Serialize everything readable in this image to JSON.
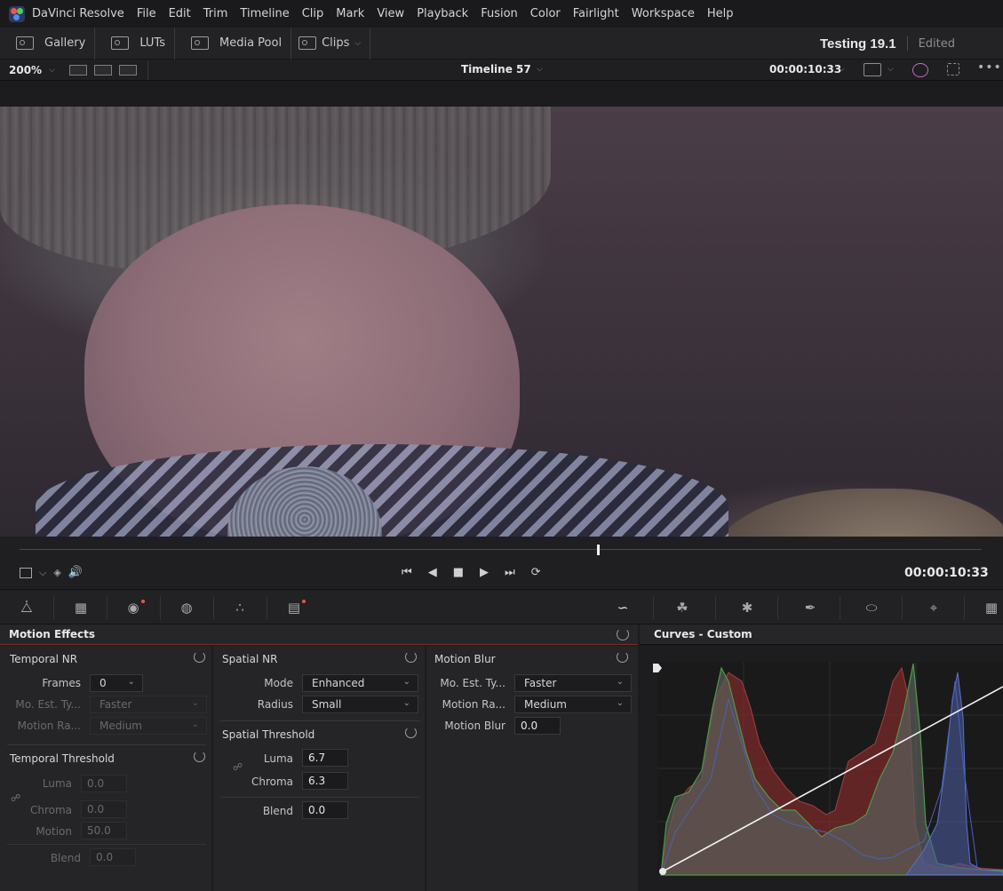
{
  "menubar": {
    "app_name": "DaVinci Resolve",
    "items": [
      "File",
      "Edit",
      "Trim",
      "Timeline",
      "Clip",
      "Mark",
      "View",
      "Playback",
      "Fusion",
      "Color",
      "Fairlight",
      "Workspace",
      "Help"
    ]
  },
  "toolbar": {
    "gallery": "Gallery",
    "luts": "LUTs",
    "media_pool": "Media Pool",
    "clips": "Clips",
    "project_name": "Testing 19.1",
    "project_status": "Edited"
  },
  "viewer": {
    "zoom": "200%",
    "timeline_name": "Timeline 57",
    "timecode": "00:00:10:33",
    "playhead_fraction": 0.601
  },
  "transport": {
    "timecode": "00:00:10:33"
  },
  "motion_effects": {
    "title": "Motion Effects",
    "temporal_nr": {
      "title": "Temporal NR",
      "frames_label": "Frames",
      "frames_value": "0",
      "mo_est_label": "Mo. Est. Ty...",
      "mo_est_value": "Faster",
      "motion_range_label": "Motion Ra...",
      "motion_range_value": "Medium"
    },
    "temporal_threshold": {
      "title": "Temporal Threshold",
      "luma_label": "Luma",
      "luma_value": "0.0",
      "chroma_label": "Chroma",
      "chroma_value": "0.0",
      "motion_label": "Motion",
      "motion_value": "50.0",
      "blend_label": "Blend",
      "blend_value": "0.0"
    },
    "spatial_nr": {
      "title": "Spatial NR",
      "mode_label": "Mode",
      "mode_value": "Enhanced",
      "radius_label": "Radius",
      "radius_value": "Small"
    },
    "spatial_threshold": {
      "title": "Spatial Threshold",
      "luma_label": "Luma",
      "luma_value": "6.7",
      "chroma_label": "Chroma",
      "chroma_value": "6.3",
      "blend_label": "Blend",
      "blend_value": "0.0"
    },
    "motion_blur": {
      "title": "Motion Blur",
      "mo_est_label": "Mo. Est. Ty...",
      "mo_est_value": "Faster",
      "motion_range_label": "Motion Ra...",
      "motion_range_value": "Medium",
      "blur_label": "Motion Blur",
      "blur_value": "0.0"
    }
  },
  "curves": {
    "title": "Curves - Custom"
  },
  "colors": {
    "accent_red": "#e25a3c",
    "panel_bg": "#252527",
    "histogram_red": "#8a3030",
    "histogram_green": "#4f8a4a",
    "histogram_blue": "#5a72c8"
  }
}
